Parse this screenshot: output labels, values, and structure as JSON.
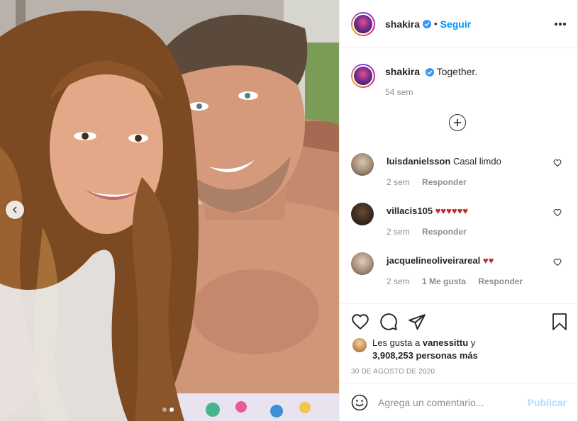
{
  "post": {
    "username": "shakira",
    "separator": "•",
    "follow_label": "Seguir",
    "caption_text": "Together.",
    "caption_age": "54 sem",
    "image_alt": "Selfie of a couple smiling"
  },
  "comments": [
    {
      "username": "luisdanielsson",
      "text": "Casal limdo",
      "age": "2 sem",
      "reply_label": "Responder",
      "likes": ""
    },
    {
      "username": "villacis105",
      "text": "♥♥♥♥♥♥",
      "age": "2 sem",
      "reply_label": "Responder",
      "likes": ""
    },
    {
      "username": "jacquelineoliveirareal",
      "text": "♥♥",
      "age": "2 sem",
      "likes": "1 Me gusta",
      "reply_label": "Responder"
    }
  ],
  "likes": {
    "prefix": "Les gusta a",
    "user": "vanessittu",
    "suffix": "y",
    "count": "3,908,253 personas más"
  },
  "date": "30 DE AGOSTO DE 2020",
  "comment_input": {
    "placeholder": "Agrega un comentario...",
    "publish_label": "Publicar"
  },
  "carousel": {
    "slide_index": 2,
    "slide_count": 2
  },
  "icons": {
    "verified": "verified-badge-icon",
    "more": "more-options-icon",
    "load_more": "plus-circle-icon",
    "like": "heart-icon",
    "comment": "comment-icon",
    "share": "share-icon",
    "save": "bookmark-icon",
    "emoji": "emoji-icon",
    "prev": "chevron-left-icon"
  },
  "colors": {
    "accent": "#0095f6",
    "publish_disabled": "#b3dbff",
    "heart_red": "#ed4956",
    "muted": "#8e8e8e"
  }
}
